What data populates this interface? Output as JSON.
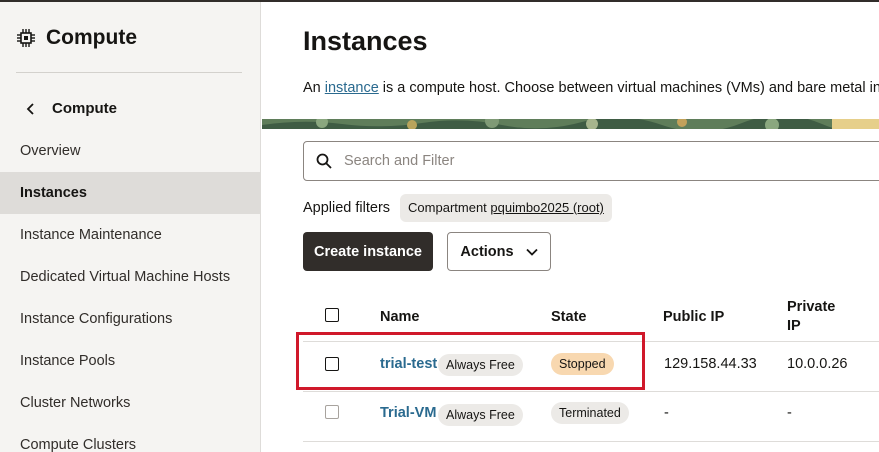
{
  "sidebar": {
    "title": "Compute",
    "back_label": "Compute",
    "items": [
      {
        "label": "Overview",
        "active": false
      },
      {
        "label": "Instances",
        "active": true
      },
      {
        "label": "Instance Maintenance",
        "active": false
      },
      {
        "label": "Dedicated Virtual Machine Hosts",
        "active": false
      },
      {
        "label": "Instance Configurations",
        "active": false
      },
      {
        "label": "Instance Pools",
        "active": false
      },
      {
        "label": "Cluster Networks",
        "active": false
      },
      {
        "label": "Compute Clusters",
        "active": false
      }
    ]
  },
  "main": {
    "title": "Instances",
    "intro_prefix": "An ",
    "intro_link": "instance",
    "intro_suffix": " is a compute host. Choose between virtual machines (VMs) and bare metal inst",
    "search_placeholder": "Search and Filter",
    "applied_filters_label": "Applied filters",
    "filter_chip_key": "Compartment ",
    "filter_chip_value": "pquimbo2025 (root)",
    "create_button": "Create instance",
    "actions_button": "Actions"
  },
  "table": {
    "headers": {
      "name": "Name",
      "state": "State",
      "public_ip": "Public IP",
      "private_ip_line1": "Private",
      "private_ip_line2": "IP"
    },
    "rows": [
      {
        "name": "trial-test",
        "tag": "Always Free",
        "state": "Stopped",
        "public_ip": "129.158.44.33",
        "private_ip": "10.0.0.26"
      },
      {
        "name": "Trial-VM",
        "tag": "Always Free",
        "state": "Terminated",
        "public_ip": "-",
        "private_ip": "-"
      }
    ]
  },
  "colors": {
    "accent_link": "#2a6a8f",
    "primary_button": "#312d2a",
    "stopped_badge": "#f8d8b0",
    "highlight_box": "#d0182a"
  },
  "icons": {
    "sidebar_header": "chip-icon",
    "back": "chevron-left-icon",
    "search": "search-icon",
    "actions": "chevron-down-icon"
  }
}
